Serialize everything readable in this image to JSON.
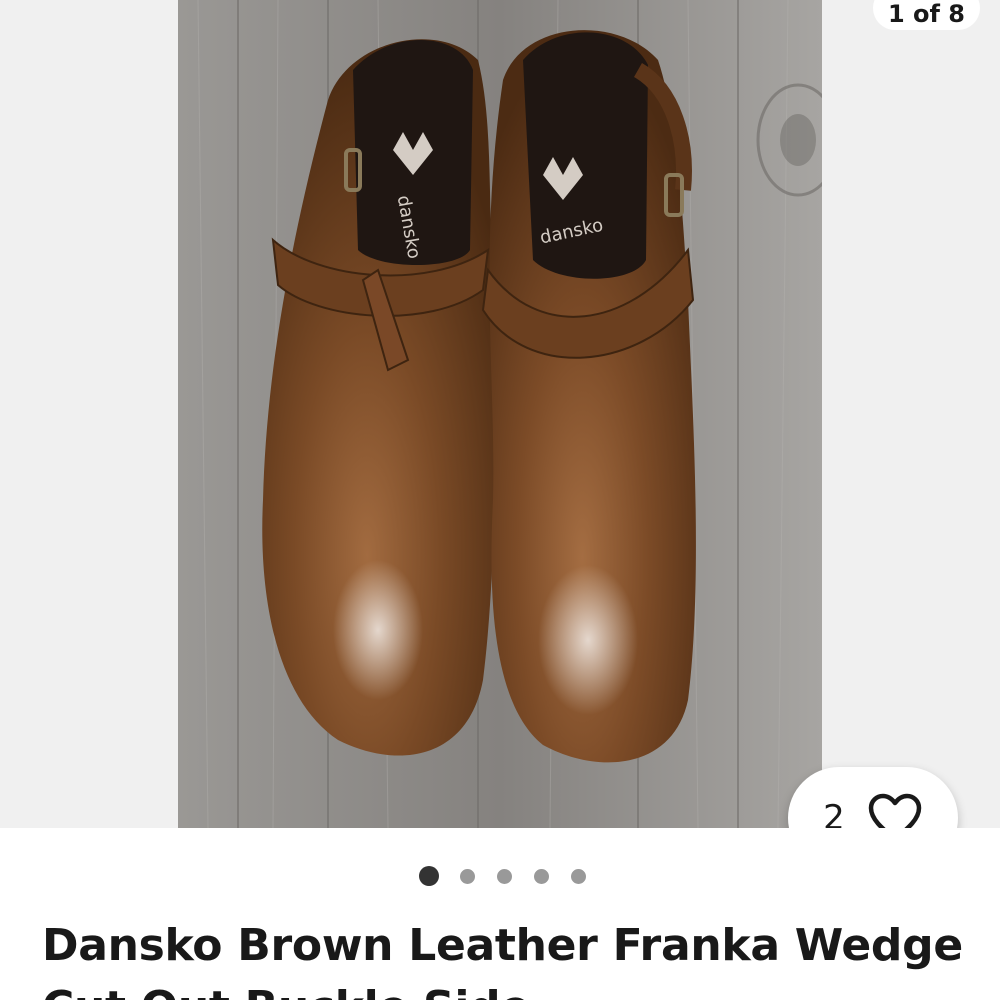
{
  "gallery": {
    "counter_label": "1 of 8",
    "photo_alt": "",
    "dots": [
      {
        "active": true
      },
      {
        "active": false
      },
      {
        "active": false
      },
      {
        "active": false
      },
      {
        "active": false
      }
    ]
  },
  "watch": {
    "count": "2",
    "icon": "heart-outline-icon"
  },
  "listing": {
    "title": "Dansko Brown Leather Franka Wedge Cut Out Buckle Side"
  },
  "photo_text": {
    "insole_brand": "dansko"
  },
  "colors": {
    "text": "#191919",
    "dot_active": "#333333",
    "dot_inactive": "#999999",
    "gallery_bg": "#f0f0f0"
  }
}
